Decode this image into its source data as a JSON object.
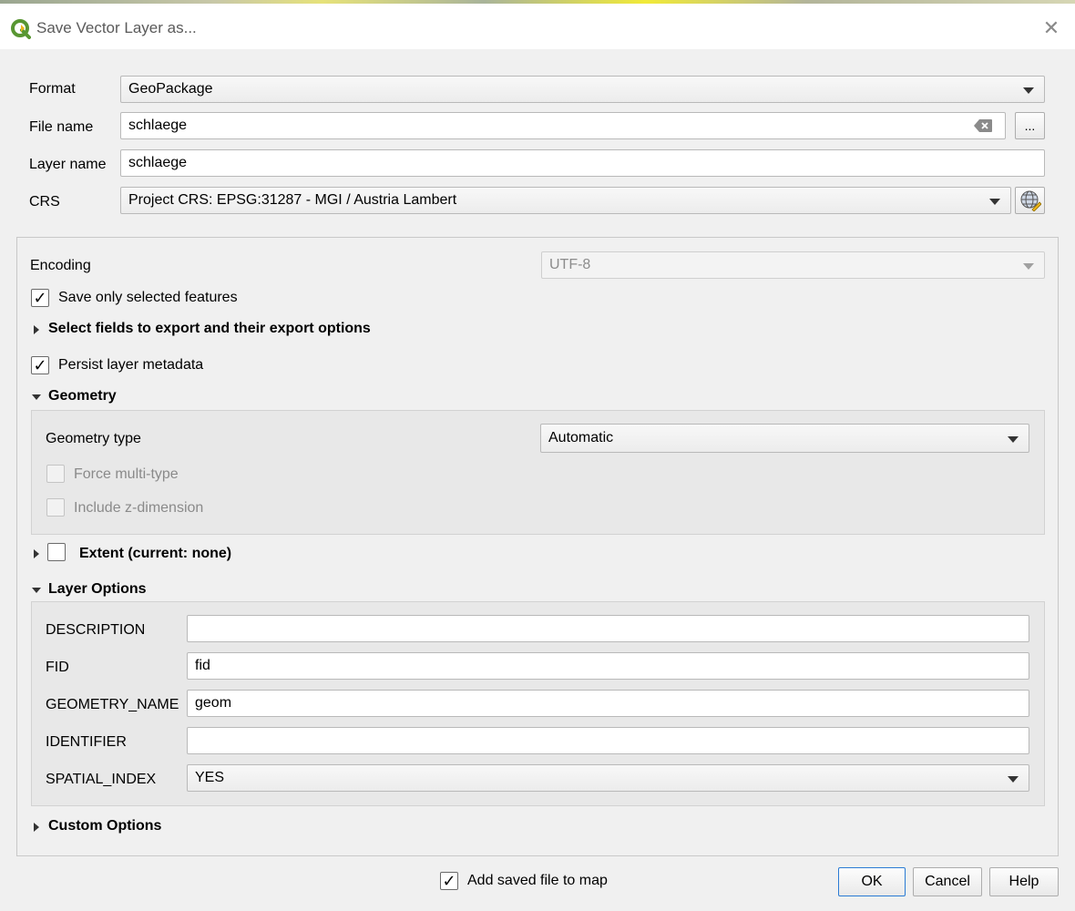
{
  "window": {
    "title": "Save Vector Layer as...",
    "close_glyph": "✕"
  },
  "top_form": {
    "format_label": "Format",
    "format_value": "GeoPackage",
    "filename_label": "File name",
    "filename_value": "schlaege",
    "browse_label": "...",
    "layername_label": "Layer name",
    "layername_value": "schlaege",
    "crs_label": "CRS",
    "crs_value": "Project CRS: EPSG:31287 - MGI / Austria Lambert"
  },
  "main": {
    "encoding_label": "Encoding",
    "encoding_value": "UTF-8",
    "save_selected_label": "Save only selected features",
    "save_selected_checked": true,
    "select_fields_label": "Select fields to export and their export options",
    "persist_metadata_label": "Persist layer metadata",
    "persist_metadata_checked": true,
    "geometry_section_label": "Geometry",
    "geometry_type_label": "Geometry type",
    "geometry_type_value": "Automatic",
    "force_multi_label": "Force multi-type",
    "include_z_label": "Include z-dimension",
    "extent_label": "Extent (current: none)",
    "layer_options_label": "Layer Options",
    "layer_options": [
      {
        "label": "DESCRIPTION",
        "value": ""
      },
      {
        "label": "FID",
        "value": "fid"
      },
      {
        "label": "GEOMETRY_NAME",
        "value": "geom"
      },
      {
        "label": "IDENTIFIER",
        "value": ""
      },
      {
        "label": "SPATIAL_INDEX",
        "value": "YES"
      }
    ],
    "custom_options_label": "Custom Options"
  },
  "footer": {
    "add_to_map_label": "Add saved file to map",
    "add_to_map_checked": true,
    "ok_label": "OK",
    "cancel_label": "Cancel",
    "help_label": "Help"
  },
  "icons": {
    "check_glyph": "✓"
  },
  "colors": {
    "qgis_green": "#589632",
    "qgis_yellow": "#eeb51a",
    "accent_border": "#2a7bd4"
  }
}
